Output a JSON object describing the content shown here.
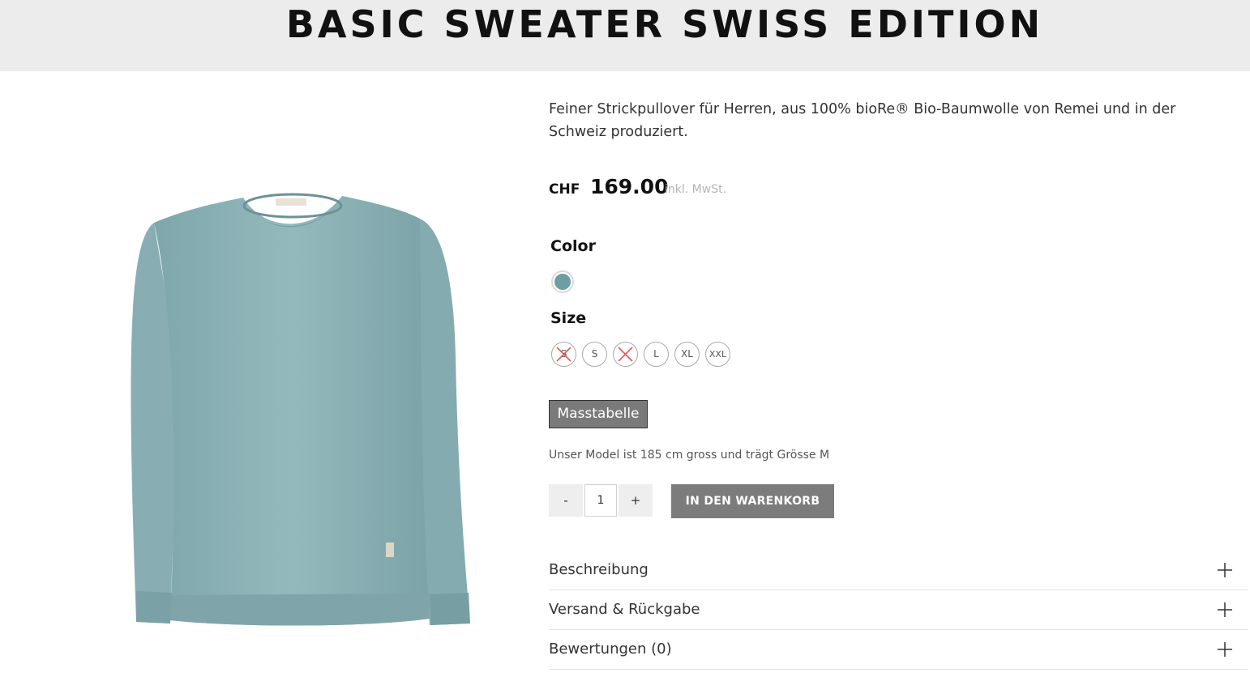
{
  "product": {
    "title": "BASIC SWEATER SWISS EDITION",
    "image_icon": "sweater-product-image",
    "description": "Feiner Strickpullover für Herren, aus 100% bioRe® Bio-Baumwolle von Remei und in der Schweiz produziert.",
    "price": {
      "currency": "CHF",
      "amount": "169.00",
      "vat_note": "inkl. MwSt."
    },
    "color": {
      "label": "Color",
      "options": [
        {
          "name": "teal",
          "hex": "#6c9ea3"
        }
      ]
    },
    "size": {
      "label": "Size",
      "options": [
        {
          "label": "S",
          "available": false
        },
        {
          "label": "S",
          "available": true
        },
        {
          "label": "",
          "available": false
        },
        {
          "label": "L",
          "available": true
        },
        {
          "label": "XL",
          "available": true
        },
        {
          "label": "XXL",
          "available": true
        }
      ]
    },
    "size_chart_button": "Masstabelle",
    "model_note": "Unser Model ist 185 cm gross und trägt Grösse M",
    "quantity": {
      "minus": "-",
      "value": "1",
      "plus": "+"
    },
    "add_to_cart": "IN DEN WARENKORB",
    "accordion": [
      {
        "label": "Beschreibung"
      },
      {
        "label": "Versand & Rückgabe"
      },
      {
        "label": "Bewertungen (0)"
      }
    ]
  },
  "colors": {
    "header_background": "#ececec",
    "sweater": "#8fb4b9",
    "button_gray": "#7c7c7c",
    "unavailable_cross": "#e05a5a"
  }
}
